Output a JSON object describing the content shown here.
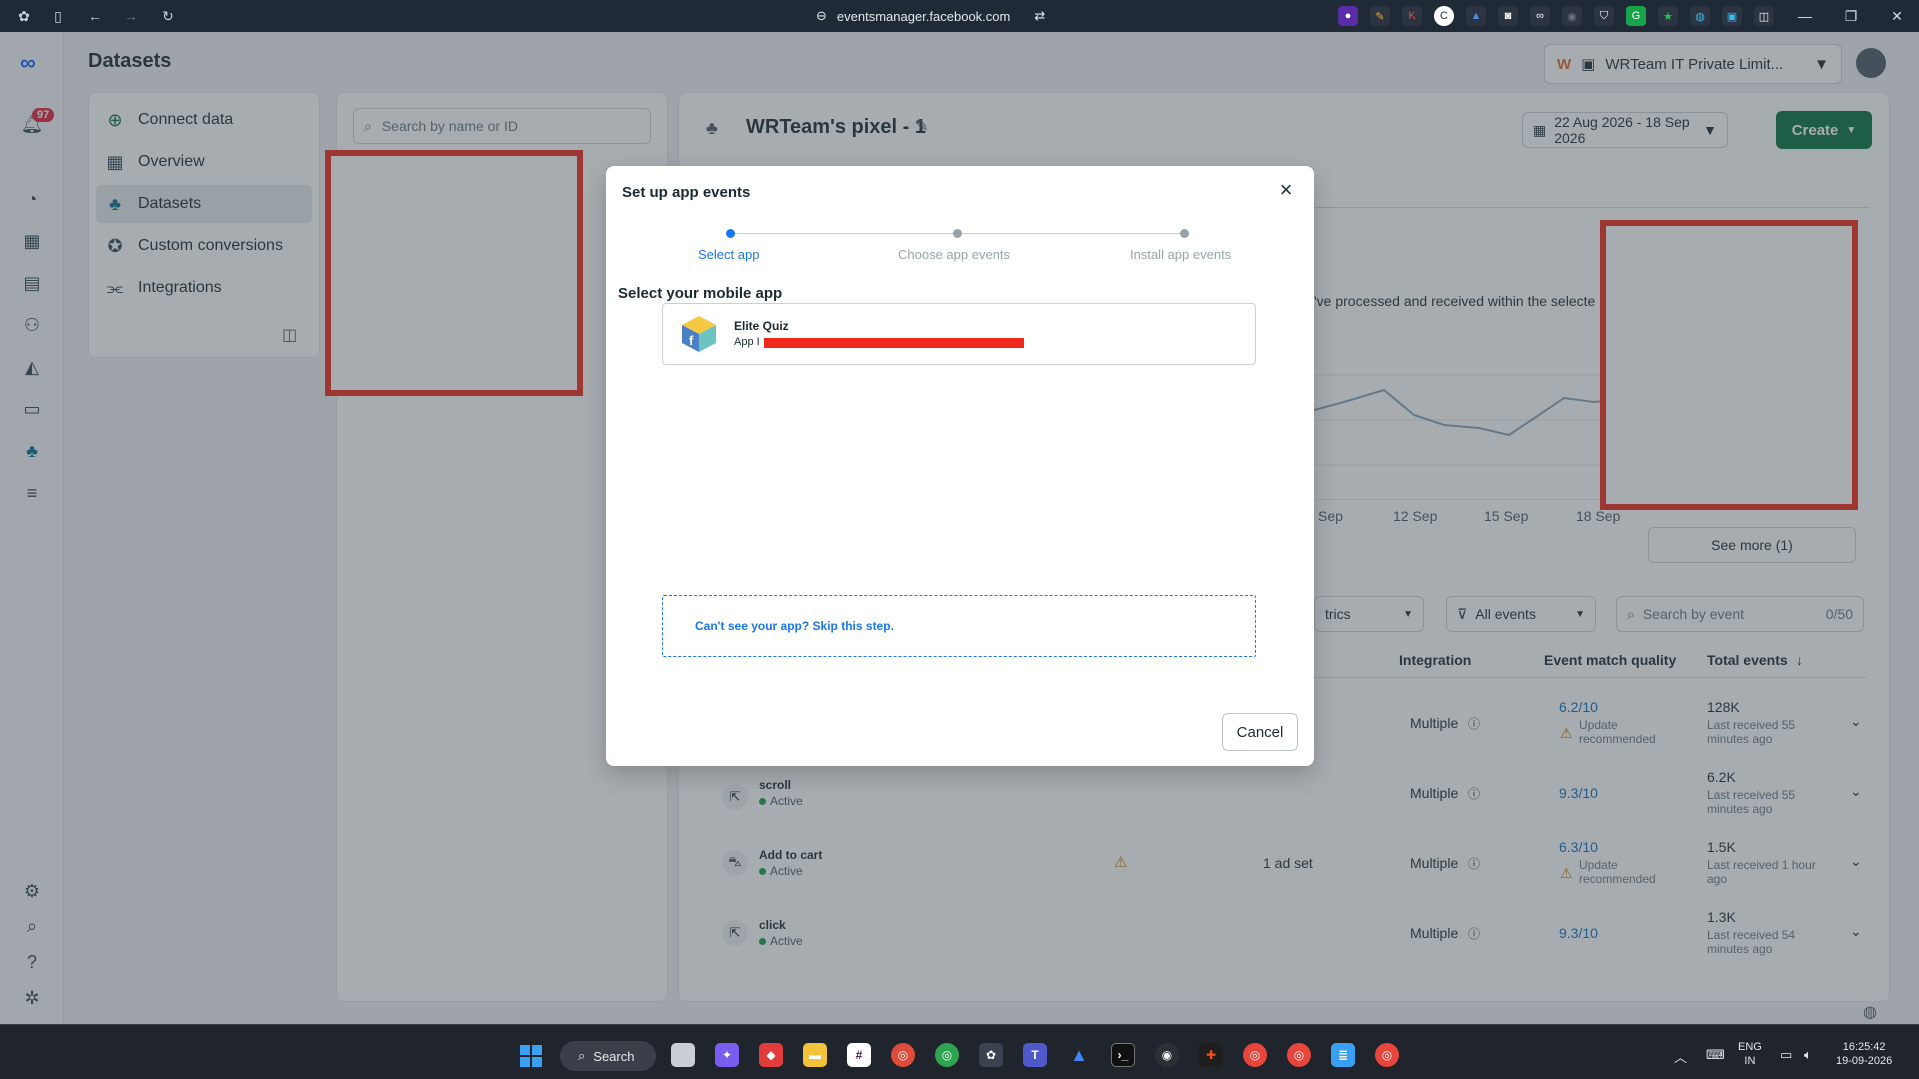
{
  "browser": {
    "url": "eventsmanager.facebook.com"
  },
  "rail": {
    "notification_count": "97"
  },
  "header": {
    "page_title": "Datasets",
    "account_name": "WRTeam IT Private Limit..."
  },
  "sidenav": {
    "items": [
      {
        "label": "Connect data",
        "icon": "plus-circle-icon"
      },
      {
        "label": "Overview",
        "icon": "grid-icon"
      },
      {
        "label": "Datasets",
        "icon": "dataset-icon"
      },
      {
        "label": "Custom conversions",
        "icon": "star-circle-icon"
      },
      {
        "label": "Integrations",
        "icon": "integrations-icon"
      }
    ]
  },
  "list": {
    "search_placeholder": "Search by name or ID"
  },
  "main": {
    "pixel_title": "WRTeam's pixel - 1",
    "date_range": "22 Aug 2026 - 18 Sep 2026",
    "create_label": "Create",
    "description_fragment": "'ve processed and received within the selecte",
    "x_ticks": [
      "Sep",
      "12 Sep",
      "15 Sep",
      "18 Sep"
    ],
    "see_more": "See more (1)",
    "filters": {
      "metrics": "trics",
      "events": "All events",
      "search_placeholder": "Search by event",
      "search_count": "0/50"
    },
    "columns": {
      "integration": "Integration",
      "emq": "Event match quality",
      "total": "Total events"
    },
    "rows": [
      {
        "event": "",
        "status": "",
        "ad_sets": "",
        "integration": "Multiple",
        "emq": "6.2/10",
        "emq_note": "Update recommended",
        "total": "128K",
        "last": "Last received 55 minutes ago"
      },
      {
        "event": "scroll",
        "status": "Active",
        "ad_sets": "",
        "integration": "Multiple",
        "emq": "9.3/10",
        "emq_note": "",
        "total": "6.2K",
        "last": "Last received 55 minutes ago"
      },
      {
        "event": "Add to cart",
        "status": "Active",
        "ad_sets": "1 ad set",
        "integration": "Multiple",
        "emq": "6.3/10",
        "emq_note": "Update recommended",
        "total": "1.5K",
        "last": "Last received 1 hour ago"
      },
      {
        "event": "click",
        "status": "Active",
        "ad_sets": "",
        "integration": "Multiple",
        "emq": "9.3/10",
        "emq_note": "",
        "total": "1.3K",
        "last": "Last received 54 minutes ago"
      }
    ]
  },
  "chart_data": {
    "type": "line",
    "x": [
      "Sep",
      "12 Sep",
      "15 Sep",
      "18 Sep"
    ],
    "xlabel": "",
    "ylabel": ""
  },
  "modal": {
    "title": "Set up app events",
    "steps": [
      "Select app",
      "Choose app events",
      "Install app events"
    ],
    "active_step": 0,
    "section_label": "Select your mobile app",
    "app_name": "Elite Quiz",
    "app_id_prefix": "App I",
    "skip_text": "Can't see your app? Skip this step.",
    "cancel_label": "Cancel"
  },
  "taskbar": {
    "search_label": "Search",
    "lang": "ENG",
    "region": "IN",
    "time": "16:25:42",
    "date": "19-09-2026"
  }
}
